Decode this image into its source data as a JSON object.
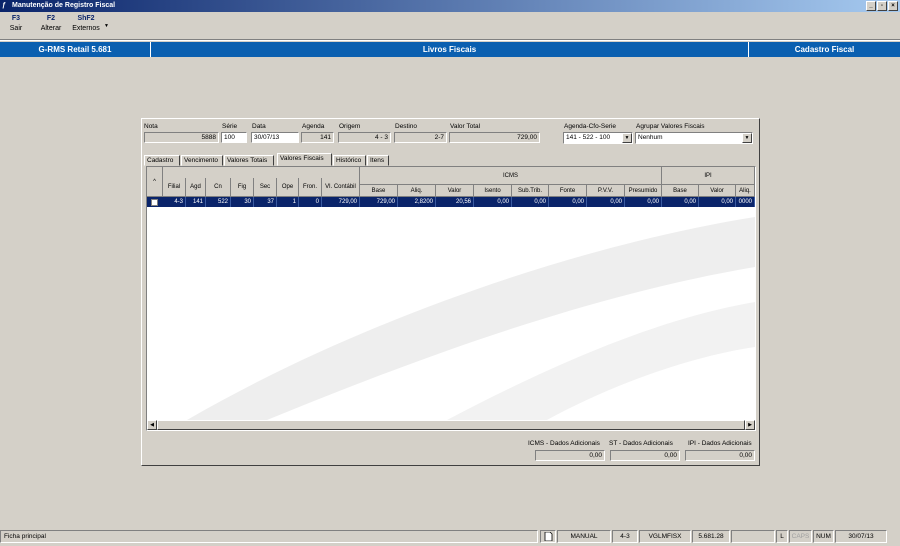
{
  "window": {
    "title": "Manutenção de Registro Fiscal"
  },
  "toolbar": {
    "sair": {
      "key": "F3",
      "label": "Sair"
    },
    "alterar": {
      "key": "F2",
      "label": "Alterar"
    },
    "externos": {
      "key": "ShF2",
      "label": "Externos"
    }
  },
  "header": {
    "app": "G-RMS Retail 5.681",
    "module": "Livros Fiscais",
    "screen": "Cadastro Fiscal"
  },
  "form": {
    "nota": {
      "label": "Nota",
      "value": "5888"
    },
    "serie": {
      "label": "Série",
      "value": "100"
    },
    "data": {
      "label": "Data",
      "value": "30/07/13"
    },
    "agenda": {
      "label": "Agenda",
      "value": "141"
    },
    "origem": {
      "label": "Origem",
      "value": "4 - 3"
    },
    "destino": {
      "label": "Destino",
      "value": "2-7"
    },
    "valor_total": {
      "label": "Valor Total",
      "value": "729,00"
    },
    "agenda_cfo_serie": {
      "label": "Agenda-Cfo-Serie",
      "value": "141 - 522 - 100"
    },
    "agrupar": {
      "label": "Agrupar Valores Fiscais",
      "value": "Nenhum"
    }
  },
  "tabs": [
    "Cadastro",
    "Vencimento",
    "Valores Totais",
    "Valores Fiscais",
    "Histórico",
    "Itens"
  ],
  "active_tab": "Valores Fiscais",
  "grid": {
    "group_icms": "ICMS",
    "group_ipi": "IPI",
    "sort_marker": "^",
    "columns": [
      "Filial",
      "Agd",
      "Cn",
      "Fig",
      "Sec",
      "Ope",
      "Fron.",
      "Vl. Contábil",
      "Base",
      "Aliq.",
      "Valor",
      "Isento",
      "Sub.Trib.",
      "Fonte",
      "P.V.V.",
      "Presumido",
      "Base",
      "Valor",
      "Aliq."
    ],
    "row": [
      "4-3",
      "141",
      "522",
      "30",
      "37",
      "1",
      "0",
      "729,00",
      "729,00",
      "2,8200",
      "20,56",
      "0,00",
      "0,00",
      "0,00",
      "0,00",
      "0,00",
      "0,00",
      "0,00",
      "0000"
    ]
  },
  "summary": {
    "icms": {
      "label": "ICMS - Dados Adicionais",
      "value": "0,00"
    },
    "st": {
      "label": "ST - Dados Adicionais",
      "value": "0,00"
    },
    "ipi": {
      "label": "IPI - Dados Adicionais",
      "value": "0,00"
    }
  },
  "status": {
    "text": "Ficha principal",
    "mode": "MANUAL",
    "filial": "4-3",
    "program": "VGLMFISX",
    "version": "5.681.28",
    "l": "L",
    "caps": "CAPS",
    "num": "NUM",
    "date": "30/07/13"
  }
}
